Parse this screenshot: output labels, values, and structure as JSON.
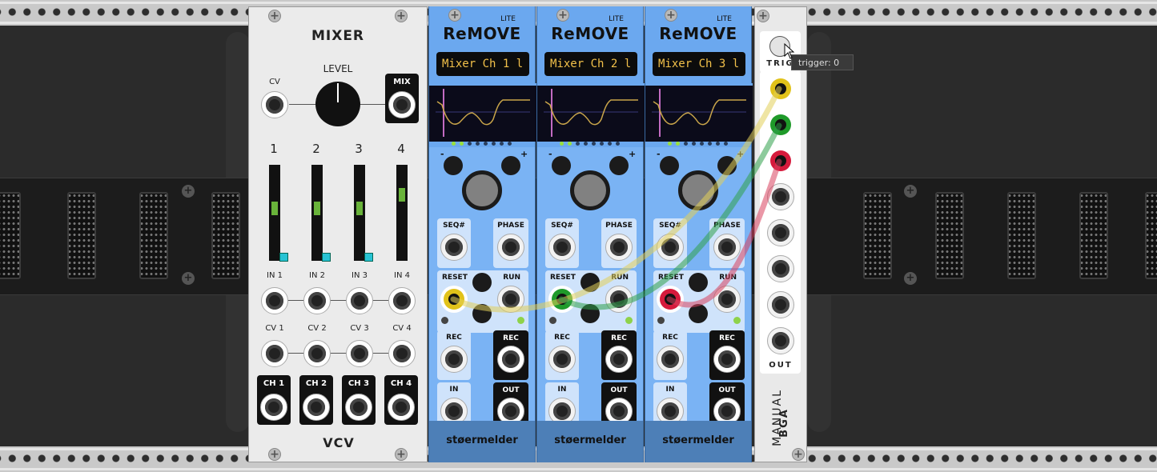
{
  "mixer": {
    "title": "MIXER",
    "level_label": "LEVEL",
    "cv_label": "CV",
    "mix_label": "MIX",
    "channel_numbers": [
      "1",
      "2",
      "3",
      "4"
    ],
    "in_labels": [
      "IN 1",
      "IN 2",
      "IN 3",
      "IN 4"
    ],
    "cv_labels": [
      "CV 1",
      "CV 2",
      "CV 3",
      "CV 4"
    ],
    "ch_labels": [
      "CH 1",
      "CH 2",
      "CH 3",
      "CH 4"
    ],
    "brand": "VCV"
  },
  "remove": [
    {
      "lite": "LITE",
      "title": "ReMOVE",
      "display": "Mixer Ch 1 l",
      "seq": "SEQ#",
      "phase": "PHASE",
      "reset": "RESET",
      "run": "RUN",
      "rec_in": "REC",
      "rec_out": "REC",
      "in": "IN",
      "out": "OUT",
      "minus": "-",
      "plus": "+",
      "brand": "stoermelder",
      "brand_display": "støermelder",
      "reset_color": "#e1c21a"
    },
    {
      "lite": "LITE",
      "title": "ReMOVE",
      "display": "Mixer Ch 2 l",
      "seq": "SEQ#",
      "phase": "PHASE",
      "reset": "RESET",
      "run": "RUN",
      "rec_in": "REC",
      "rec_out": "REC",
      "in": "IN",
      "out": "OUT",
      "minus": "-",
      "plus": "+",
      "brand": "stoermelder",
      "brand_display": "støermelder",
      "reset_color": "#1f9a2a"
    },
    {
      "lite": "LITE",
      "title": "ReMOVE",
      "display": "Mixer Ch 3 l",
      "seq": "SEQ#",
      "phase": "PHASE",
      "reset": "RESET",
      "run": "RUN",
      "rec_in": "REC",
      "rec_out": "REC",
      "in": "IN",
      "out": "OUT",
      "minus": "-",
      "plus": "+",
      "brand": "stoermelder",
      "brand_display": "støermelder",
      "reset_color": "#d61a3c"
    }
  ],
  "manual": {
    "trig_label": "TRIG",
    "out_label": "OUT",
    "name": "MANUAL",
    "brand": "BGA",
    "tooltip": "trigger: 0",
    "out_colors": [
      "#e1c21a",
      "#1f9a2a",
      "#d61a3c"
    ]
  },
  "colors": {
    "remove_blue": "#7ab3f4",
    "display_text": "#f2c14a",
    "fader_led": "#69b33a"
  }
}
